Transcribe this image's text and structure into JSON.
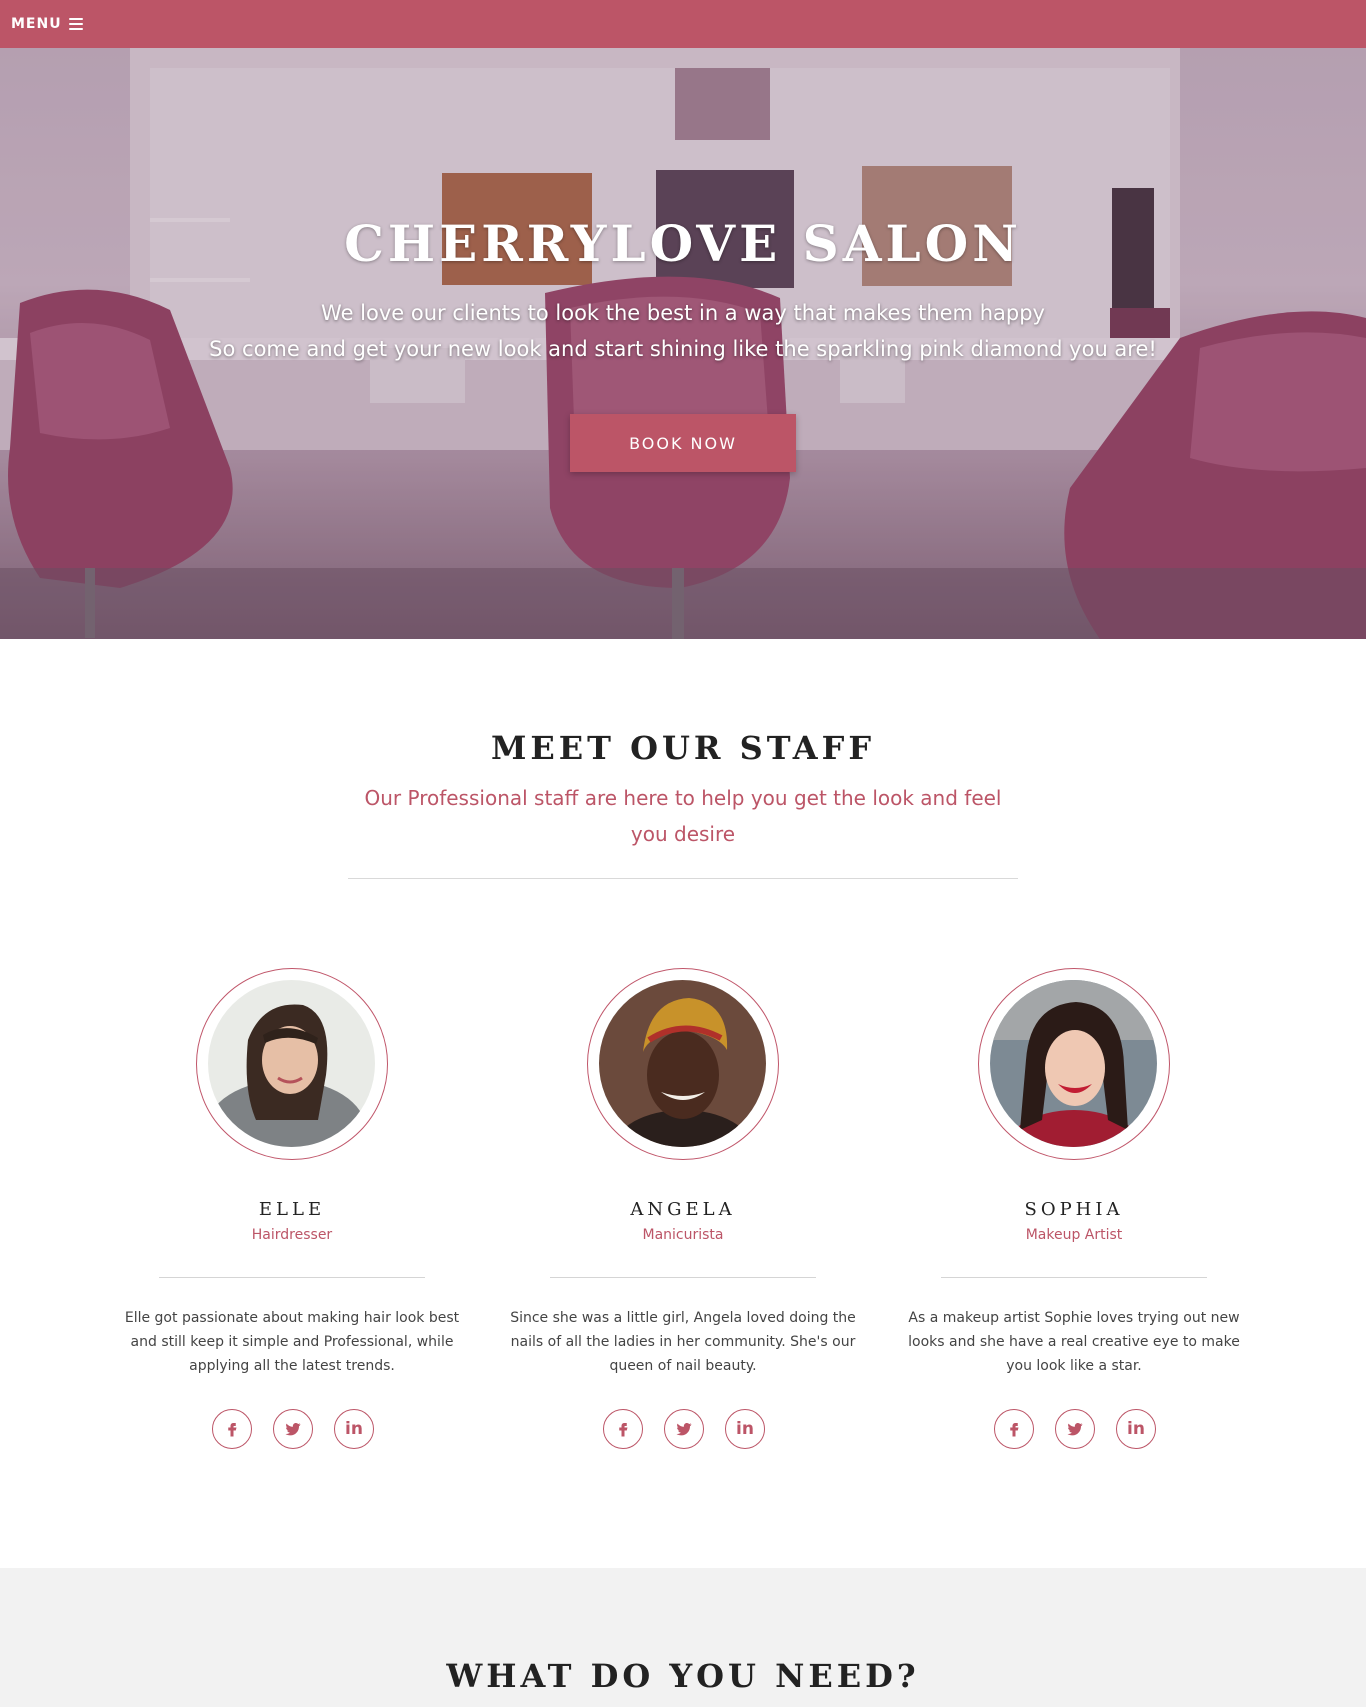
{
  "nav": {
    "menu_label": "MENU"
  },
  "hero": {
    "title": "CHERRYLOVE SALON",
    "line1": "We love our clients to look the best in a way that makes them happy",
    "line2": "So come and get your new look and start shining like the sparkling pink diamond you are!",
    "cta": "BOOK NOW"
  },
  "staff": {
    "title": "MEET OUR STAFF",
    "subtitle": "Our Professional staff are here to help you get the look and feel you desire",
    "members": [
      {
        "name": "ELLE",
        "role": "Hairdresser",
        "bio": "Elle got passionate about making hair look best and still keep it simple and Professional, while applying all the latest trends."
      },
      {
        "name": "ANGELA",
        "role": "Manicurista",
        "bio": "Since she was a little girl, Angela loved doing the nails of all the ladies in her community. She's our queen of nail beauty."
      },
      {
        "name": "SOPHIA",
        "role": "Makeup Artist",
        "bio": "As a makeup artist Sophie loves trying out new looks and she have a real creative eye to make you look like a star."
      }
    ],
    "social_icons": [
      "facebook-icon",
      "twitter-icon",
      "linkedin-icon"
    ],
    "linkedin_glyph": "in"
  },
  "need": {
    "title": "WHAT DO YOU NEED?"
  },
  "colors": {
    "accent": "#bc5567",
    "section_gray": "#f2f2f2"
  }
}
